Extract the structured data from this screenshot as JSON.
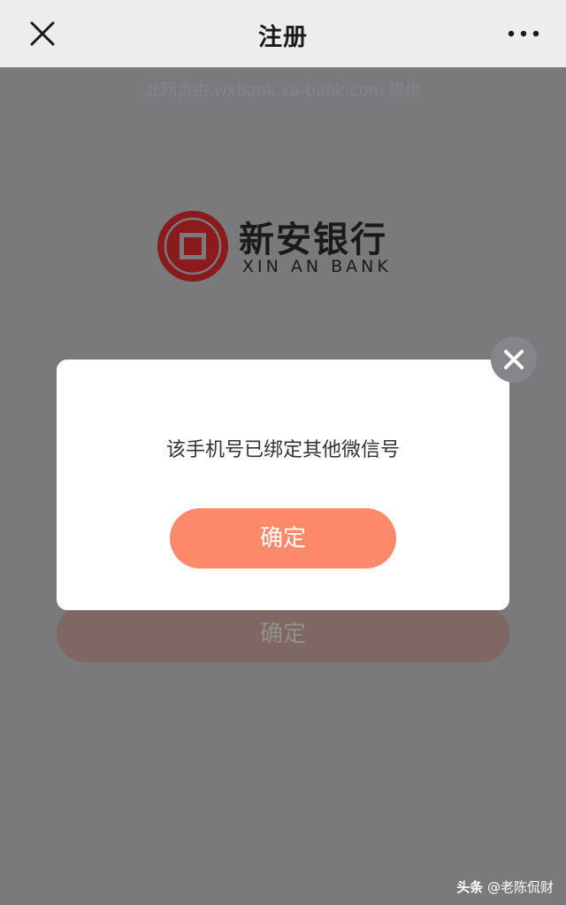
{
  "nav": {
    "title": "注册",
    "close_icon": "close-icon",
    "more_icon": "more-dots-icon"
  },
  "provider_note": "此网页由 wxbank.xa-bank.com 提供",
  "logo": {
    "name_cn": "新安银行",
    "name_en": "XIN AN BANK",
    "color": "#8b1a1c"
  },
  "background_button": {
    "label": "确定"
  },
  "dialog": {
    "message": "该手机号已绑定其他微信号",
    "confirm_label": "确定",
    "confirm_color": "#fe8a6b",
    "close_icon": "close-icon"
  },
  "watermark": {
    "source": "头条",
    "author": "@老陈侃财"
  }
}
